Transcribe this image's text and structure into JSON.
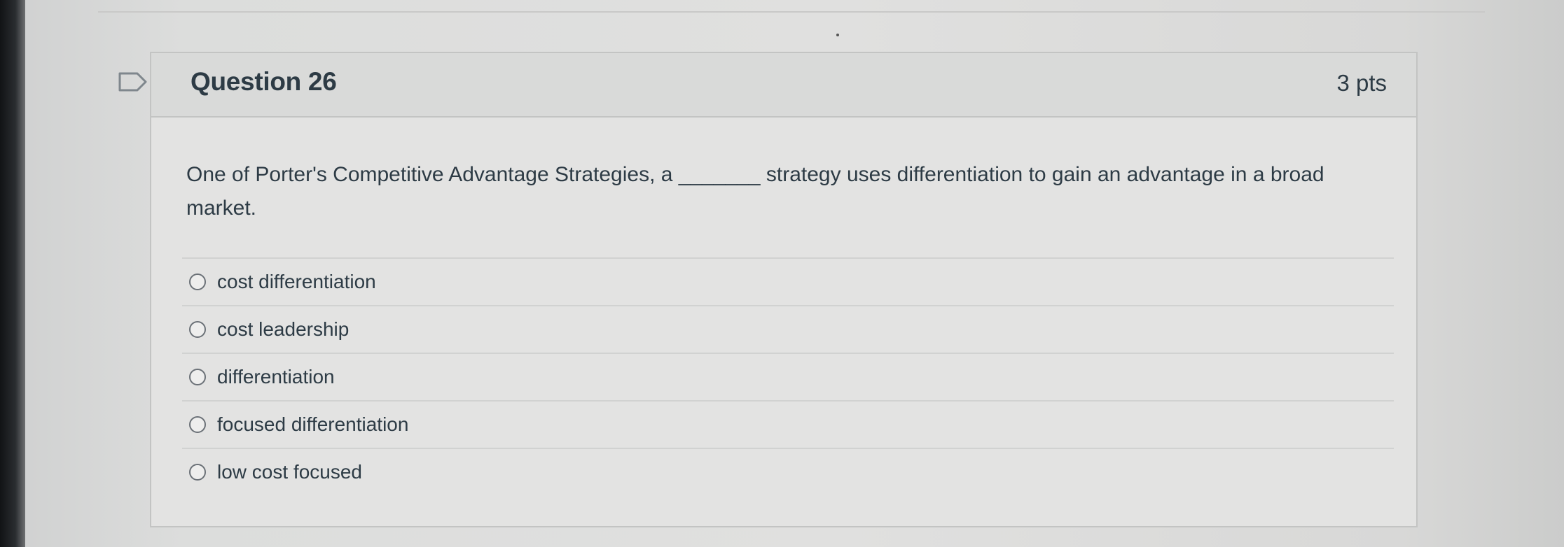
{
  "question": {
    "title": "Question 26",
    "points": "3 pts",
    "text": "One of Porter's Competitive Advantage Strategies, a _______ strategy uses differentiation to gain an advantage in a broad market."
  },
  "answers": [
    {
      "label": "cost differentiation"
    },
    {
      "label": "cost leadership"
    },
    {
      "label": "differentiation"
    },
    {
      "label": "focused differentiation"
    },
    {
      "label": "low cost focused"
    }
  ],
  "icons": {
    "flag": "flag-icon",
    "radio": "radio-button-icon"
  },
  "colors": {
    "text": "#2d3b45",
    "header_background": "#d9dad9",
    "card_background": "#e3e3e2",
    "border": "#c3c4c3"
  }
}
